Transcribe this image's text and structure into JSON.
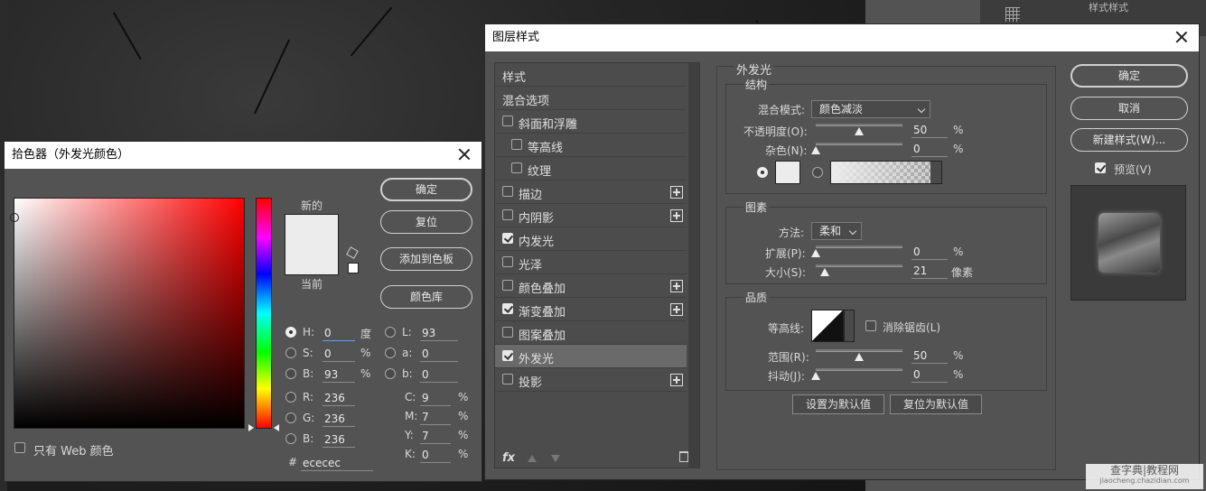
{
  "color_picker": {
    "title": "拾色器（外发光颜色）",
    "buttons": {
      "ok": "确定",
      "reset": "复位",
      "add_to_swatches": "添加到色板",
      "color_libraries": "颜色库"
    },
    "new_label": "新的",
    "current_label": "当前",
    "web_only_label": "只有 Web 颜色",
    "hsb": {
      "h_label": "H:",
      "h_value": "0",
      "h_unit": "度",
      "s_label": "S:",
      "s_value": "0",
      "s_unit": "%",
      "b_label": "B:",
      "b_value": "93",
      "b_unit": "%"
    },
    "rgb": {
      "r_label": "R:",
      "r_value": "236",
      "g_label": "G:",
      "g_value": "236",
      "b_label": "B:",
      "b_value": "236"
    },
    "lab": {
      "l_label": "L:",
      "l_value": "93",
      "a_label": "a:",
      "a_value": "0",
      "b_label": "b:",
      "b_value": "0"
    },
    "cmyk": {
      "c_label": "C:",
      "c_value": "9",
      "m_label": "M:",
      "m_value": "7",
      "y_label": "Y:",
      "y_value": "7",
      "k_label": "K:",
      "k_value": "0",
      "unit": "%"
    },
    "hex_label": "#",
    "hex_value": "ececec",
    "new_color": "#ececec"
  },
  "layer_style": {
    "title": "图层样式",
    "list": [
      {
        "label": "样式",
        "checkbox": false,
        "checked": false,
        "plus": false,
        "indent": false
      },
      {
        "label": "混合选项",
        "checkbox": false,
        "checked": false,
        "plus": false,
        "indent": false
      },
      {
        "label": "斜面和浮雕",
        "checkbox": true,
        "checked": false,
        "plus": false,
        "indent": false
      },
      {
        "label": "等高线",
        "checkbox": true,
        "checked": false,
        "plus": false,
        "indent": true
      },
      {
        "label": "纹理",
        "checkbox": true,
        "checked": false,
        "plus": false,
        "indent": true
      },
      {
        "label": "描边",
        "checkbox": true,
        "checked": false,
        "plus": true,
        "indent": false
      },
      {
        "label": "内阴影",
        "checkbox": true,
        "checked": false,
        "plus": true,
        "indent": false
      },
      {
        "label": "内发光",
        "checkbox": true,
        "checked": true,
        "plus": false,
        "indent": false
      },
      {
        "label": "光泽",
        "checkbox": true,
        "checked": false,
        "plus": false,
        "indent": false
      },
      {
        "label": "颜色叠加",
        "checkbox": true,
        "checked": false,
        "plus": true,
        "indent": false
      },
      {
        "label": "渐变叠加",
        "checkbox": true,
        "checked": true,
        "plus": true,
        "indent": false
      },
      {
        "label": "图案叠加",
        "checkbox": true,
        "checked": false,
        "plus": false,
        "indent": false
      },
      {
        "label": "外发光",
        "checkbox": true,
        "checked": true,
        "plus": false,
        "indent": false,
        "selected": true
      },
      {
        "label": "投影",
        "checkbox": true,
        "checked": false,
        "plus": true,
        "indent": false
      }
    ],
    "fx_label": "fx",
    "panel_title": "外发光",
    "structure": {
      "title": "结构",
      "blend_mode_label": "混合模式:",
      "blend_mode_value": "颜色减淡",
      "opacity_label": "不透明度(O):",
      "opacity_value": "50",
      "noise_label": "杂色(N):",
      "noise_value": "0",
      "percent": "%"
    },
    "elements": {
      "title": "图素",
      "technique_label": "方法:",
      "technique_value": "柔和",
      "spread_label": "扩展(P):",
      "spread_value": "0",
      "size_label": "大小(S):",
      "size_value": "21",
      "size_unit": "像素",
      "percent": "%"
    },
    "quality": {
      "title": "品质",
      "contour_label": "等高线:",
      "antialias_label": "消除锯齿(L)",
      "range_label": "范围(R):",
      "range_value": "50",
      "jitter_label": "抖动(J):",
      "jitter_value": "0",
      "percent": "%"
    },
    "make_default": "设置为默认值",
    "reset_default": "复位为默认值",
    "buttons": {
      "ok": "确定",
      "cancel": "取消",
      "new_style": "新建样式(W)...",
      "preview_label": "预览(V)"
    },
    "levels": {
      "opacity": 0.5,
      "noise": 0.0,
      "spread": 0.0,
      "size": 0.1,
      "range": 0.5,
      "jitter": 0.0
    }
  },
  "watermark": {
    "line1": "查字典|教程网",
    "line2": "jiaocheng.chazidian.com"
  },
  "right_strip_text": "样式样式"
}
